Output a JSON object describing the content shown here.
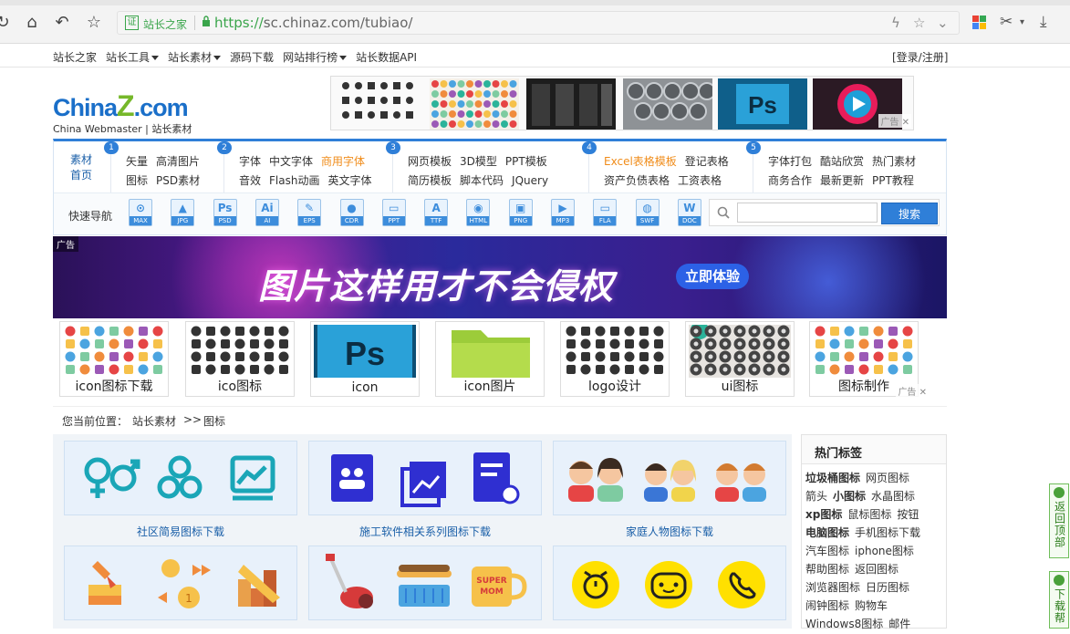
{
  "browser": {
    "site_label": "站长之家",
    "cert_glyph": "证",
    "url_scheme": "https://",
    "url_host": "sc.chinaz.com",
    "url_path": "/tubiao/"
  },
  "topbar": {
    "links": [
      "站长之家",
      "站长工具",
      "站长素材",
      "源码下载",
      "网站排行榜",
      "站长数据API"
    ],
    "dropdown_flags": [
      false,
      true,
      true,
      false,
      true,
      false
    ],
    "login": "[登录/注册]"
  },
  "logo": {
    "main_a": "China",
    "main_z": "Z",
    "main_b": ".com",
    "sub": "China Webmaster | 站长素材"
  },
  "ad_strip": {
    "tag": "广告"
  },
  "nav": {
    "home_line1": "素材",
    "home_line2": "首页",
    "groups": [
      {
        "num": "1",
        "row1": [
          "矢量",
          "高清图片"
        ],
        "row2": [
          "图标",
          "PSD素材"
        ]
      },
      {
        "num": "2",
        "row1": [
          "字体",
          "中文字体",
          "商用字体"
        ],
        "row2": [
          "音效",
          "Flash动画",
          "英文字体"
        ]
      },
      {
        "num": "3",
        "row1": [
          "网页模板",
          "3D模型",
          "PPT模板"
        ],
        "row2": [
          "简历模板",
          "脚本代码",
          "JQuery"
        ]
      },
      {
        "num": "4",
        "row1": [
          "Excel表格模板",
          "登记表格"
        ],
        "row2": [
          "资产负债表格",
          "工资表格"
        ]
      },
      {
        "num": "5",
        "row1": [
          "字体打包",
          "酷站欣赏",
          "热门素材"
        ],
        "row2": [
          "商务合作",
          "最新更新",
          "PPT教程"
        ]
      }
    ],
    "quick_label": "快速导航",
    "quick_icons": [
      "MAX",
      "JPG",
      "PSD",
      "AI",
      "EPS",
      "CDR",
      "PPT",
      "TTF",
      "HTML",
      "PNG",
      "MP3",
      "FLA",
      "SWF",
      "DOC"
    ],
    "quick_glyphs": [
      "⊙",
      "▲",
      "Ps",
      "Ai",
      "✎",
      "●",
      "▭",
      "A",
      "◉",
      "▣",
      "▶",
      "▭",
      "◍",
      "W"
    ],
    "search_placeholder": "",
    "search_button": "搜索"
  },
  "banner": {
    "tag": "广告",
    "title": "图片这样用才不会侵权",
    "cta": "立即体验"
  },
  "thumbs": [
    "icon图标下载",
    "ico图标",
    "icon",
    "icon图片",
    "logo设计",
    "ui图标",
    "图标制作"
  ],
  "thumbs_ad_tag": "广告",
  "breadcrumb": {
    "label": "您当前位置：",
    "level1": "站长素材",
    "sep": ">>",
    "level2": "图标"
  },
  "cards": [
    {
      "label": "社区简易图标下载"
    },
    {
      "label": "施工软件相关系列图标下载"
    },
    {
      "label": "家庭人物图标下载"
    },
    {
      "label": ""
    },
    {
      "label": ""
    },
    {
      "label": ""
    }
  ],
  "sidebar": {
    "title": "热门标签",
    "rows": [
      [
        {
          "t": "垃圾桶图标",
          "s": "b"
        },
        {
          "t": "网页图标",
          "s": ""
        }
      ],
      [
        {
          "t": "箭头",
          "s": ""
        },
        {
          "t": "小图标",
          "s": "b"
        },
        {
          "t": "水晶图标",
          "s": ""
        }
      ],
      [
        {
          "t": "xp图标",
          "s": "red"
        },
        {
          "t": "鼠标图标",
          "s": ""
        },
        {
          "t": "按钮",
          "s": ""
        }
      ],
      [
        {
          "t": "电脑图标",
          "s": "b"
        },
        {
          "t": "手机图标下载",
          "s": ""
        }
      ],
      [
        {
          "t": "汽车图标",
          "s": "blue"
        },
        {
          "t": "iphone图标",
          "s": ""
        }
      ],
      [
        {
          "t": "帮助图标",
          "s": ""
        },
        {
          "t": "返回图标",
          "s": ""
        }
      ],
      [
        {
          "t": "浏览器图标",
          "s": ""
        },
        {
          "t": "日历图标",
          "s": ""
        }
      ],
      [
        {
          "t": "闹钟图标",
          "s": ""
        },
        {
          "t": "购物车",
          "s": ""
        }
      ],
      [
        {
          "t": "Windows8图标",
          "s": ""
        },
        {
          "t": "邮件",
          "s": ""
        }
      ]
    ]
  },
  "float": {
    "top": "返回顶部",
    "down": "下载帮"
  },
  "colors": {
    "brand_blue": "#2f7fd8",
    "brand_green": "#76b82a",
    "accent_orange": "#f08c1a"
  }
}
